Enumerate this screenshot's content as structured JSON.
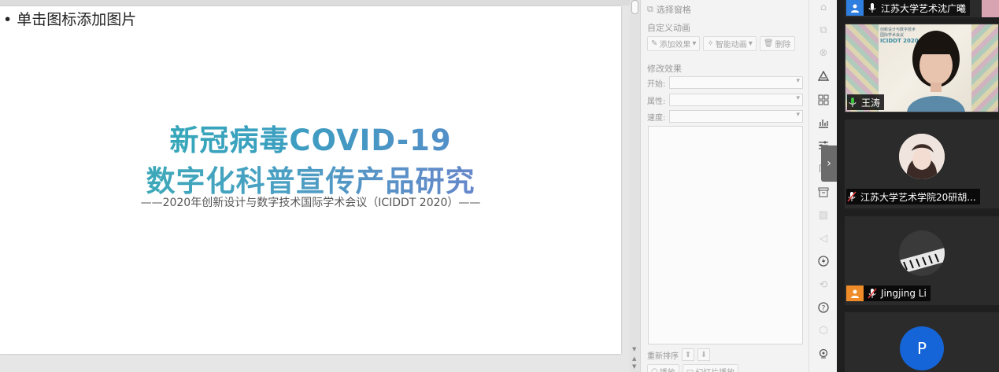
{
  "slide": {
    "placeholder": "• 单击图标添加图片",
    "title_line1": "新冠病毒COVID-19",
    "title_line2": "数字化科普宣传产品研究",
    "subtitle": "——2020年创新设计与数字技术国际学术会议（ICIDDT 2020）——"
  },
  "animation_panel": {
    "select_pane": "选择窗格",
    "custom_animation": "自定义动画",
    "add_effect": "添加效果",
    "smart_animation": "智能动画",
    "delete": "删除",
    "modify_effect": "修改效果",
    "start_label": "开始:",
    "property_label": "属性:",
    "speed_label": "速度:",
    "reorder": "重新排序",
    "play": "播放",
    "slideshow_play": "幻灯片播放"
  },
  "participants": [
    {
      "name": "江苏大学艺术沈广曦"
    },
    {
      "name": "王涛",
      "poster_line1": "创新设计与数字技术",
      "poster_line2": "国际学术会议",
      "poster_big": "ICIDDT 2020"
    },
    {
      "name": "江苏大学艺术学院20研胡..."
    },
    {
      "name": "Jingjing Li"
    },
    {
      "initial": "P"
    }
  ],
  "colors": {
    "title_start": "#2fb2b0",
    "title_end": "#7a74cf",
    "mic_active": "#3cc13b",
    "mic_muted": "#e23b3b",
    "avatar_blue": "#2f7fe0",
    "avatar_orange": "#f08c28"
  }
}
